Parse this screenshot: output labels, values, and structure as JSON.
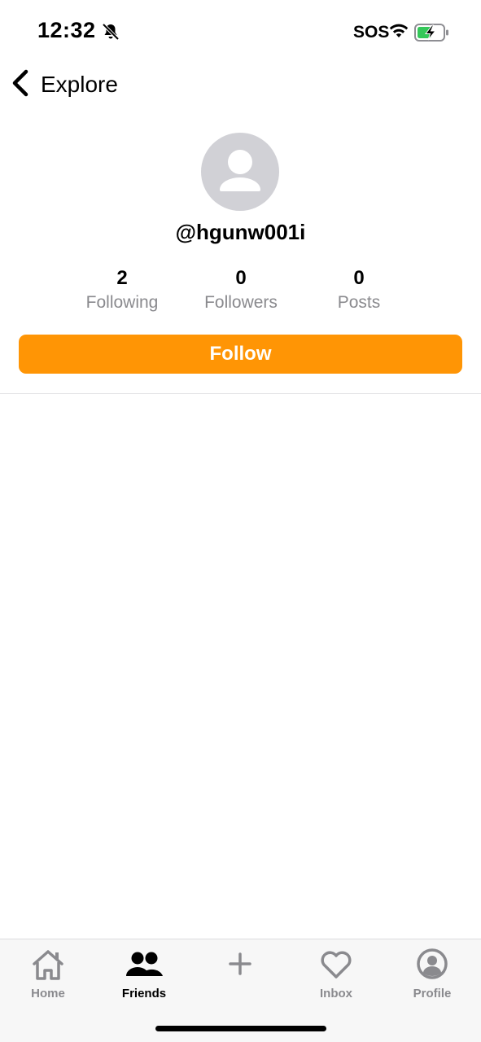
{
  "status_bar": {
    "time": "12:32",
    "sos": "SOS",
    "bell_icon": "bell-slash-icon",
    "wifi_icon": "wifi-icon",
    "battery_icon": "battery-charging-icon",
    "battery_color": "#34c759"
  },
  "header": {
    "back_icon": "chevron-left-icon",
    "back_label": "Explore"
  },
  "profile": {
    "avatar_icon": "person-placeholder-icon",
    "username": "@hgunw001i",
    "stats": [
      {
        "value": "2",
        "label": "Following"
      },
      {
        "value": "0",
        "label": "Followers"
      },
      {
        "value": "0",
        "label": "Posts"
      }
    ],
    "follow_label": "Follow"
  },
  "tab_bar": {
    "tabs": [
      {
        "icon": "house-icon",
        "label": "Home",
        "active": false
      },
      {
        "icon": "people-icon",
        "label": "Friends",
        "active": true
      },
      {
        "icon": "plus-icon",
        "label": "",
        "active": false
      },
      {
        "icon": "heart-icon",
        "label": "Inbox",
        "active": false
      },
      {
        "icon": "person-circle-icon",
        "label": "Profile",
        "active": false
      }
    ]
  },
  "colors": {
    "accent": "#ff9505",
    "inactive_tab": "#8a8a8e",
    "avatar_bg": "#d1d1d6"
  }
}
